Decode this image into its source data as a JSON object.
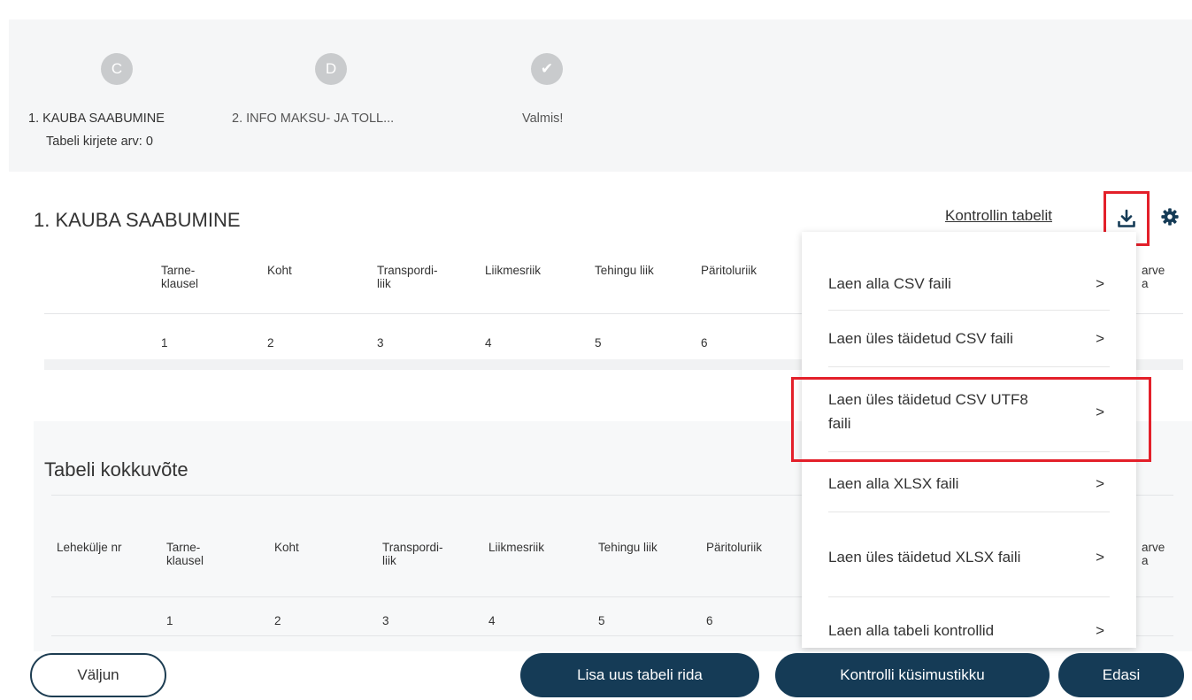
{
  "stepper": {
    "steps": [
      {
        "badge": "C",
        "label": "1. KAUBA SAABUMINE"
      },
      {
        "badge": "D",
        "label": "2. INFO MAKSU- JA TOLL..."
      },
      {
        "badge": "✔",
        "label": "Valmis!"
      }
    ],
    "record_count": "Tabeli kirjete arv: 0"
  },
  "main_table": {
    "title": "1. KAUBA SAABUMINE",
    "check_link": "Kontrollin tabelit",
    "headers": [
      "Tarne-\nklausel",
      "Koht",
      "Transpordi-\nliik",
      "Liikmesriik",
      "Tehingu liik",
      "Päritoluriik"
    ],
    "header_partial_right": "arve\na",
    "row": [
      "1",
      "2",
      "3",
      "4",
      "5",
      "6"
    ]
  },
  "summary_table": {
    "title": "Tabeli kokkuvõte",
    "first_header": "Lehekülje nr",
    "headers": [
      "Tarne-\nklausel",
      "Koht",
      "Transpordi-\nliik",
      "Liikmesriik",
      "Tehingu liik",
      "Päritoluriik"
    ],
    "header_partial_right": "arve\na",
    "row": [
      "1",
      "2",
      "3",
      "4",
      "5",
      "6"
    ]
  },
  "dropdown": {
    "items": [
      {
        "label": "Laen alla CSV faili"
      },
      {
        "label": "Laen üles täidetud CSV faili"
      },
      {
        "label": "Laen üles täidetud CSV UTF8 faili"
      },
      {
        "label": "Laen alla XLSX faili"
      },
      {
        "label": "Laen üles täidetud XLSX faili"
      },
      {
        "label": "Laen alla tabeli kontrollid"
      }
    ],
    "chevron": ">"
  },
  "buttons": {
    "exit": "Väljun",
    "add_row": "Lisa uus tabeli rida",
    "check_questionnaire": "Kontrolli küsimustikku",
    "next": "Edasi"
  },
  "colors": {
    "dark_button": "#153b56",
    "highlight": "#e3202a",
    "step_badge": "#c9cbcd"
  }
}
